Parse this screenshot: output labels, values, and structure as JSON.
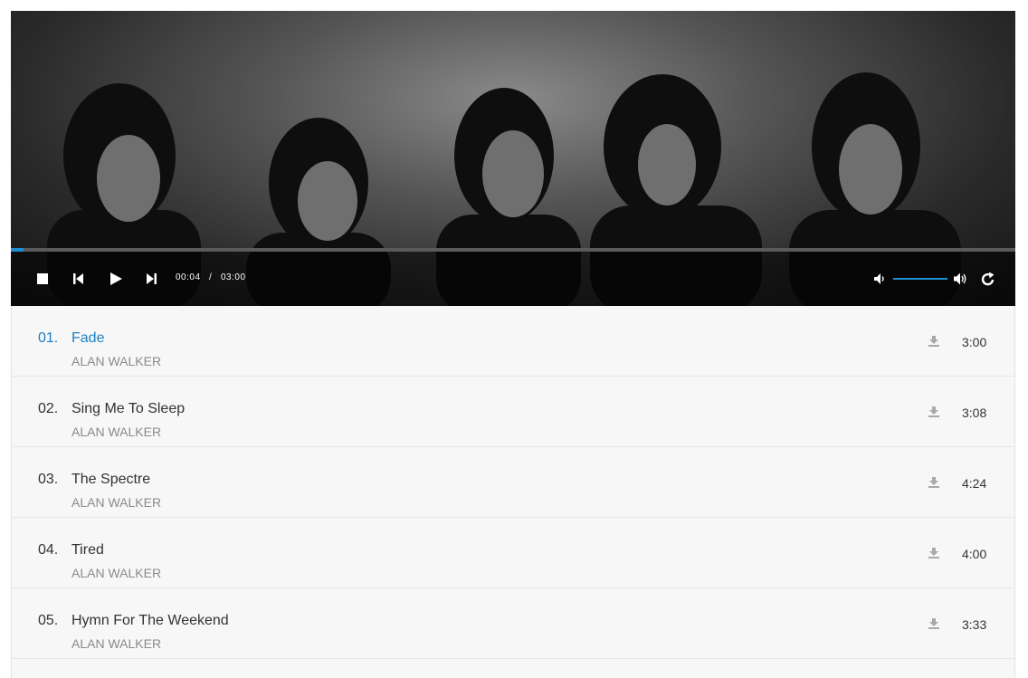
{
  "player": {
    "progress_fraction": 0.013,
    "time_current": "00:04",
    "time_separator": "/",
    "time_total": "03:00",
    "volume_fraction": 1.0,
    "accent_color": "#1c8fd1",
    "icons": [
      "stop-icon",
      "previous-icon",
      "play-icon",
      "next-icon",
      "volume-mute-icon",
      "volume-max-icon",
      "repeat-icon"
    ]
  },
  "playlist": {
    "active_color": "#1c7fc3",
    "tracks": [
      {
        "num": "01.",
        "title": "Fade",
        "artist": "ALAN WALKER",
        "duration": "3:00",
        "active": true
      },
      {
        "num": "02.",
        "title": "Sing Me To Sleep",
        "artist": "ALAN WALKER",
        "duration": "3:08",
        "active": false
      },
      {
        "num": "03.",
        "title": "The Spectre",
        "artist": "ALAN WALKER",
        "duration": "4:24",
        "active": false
      },
      {
        "num": "04.",
        "title": "Tired",
        "artist": "ALAN WALKER",
        "duration": "4:00",
        "active": false
      },
      {
        "num": "05.",
        "title": "Hymn For The Weekend",
        "artist": "ALAN WALKER",
        "duration": "3:33",
        "active": false
      }
    ],
    "download_icon": "download-icon"
  }
}
